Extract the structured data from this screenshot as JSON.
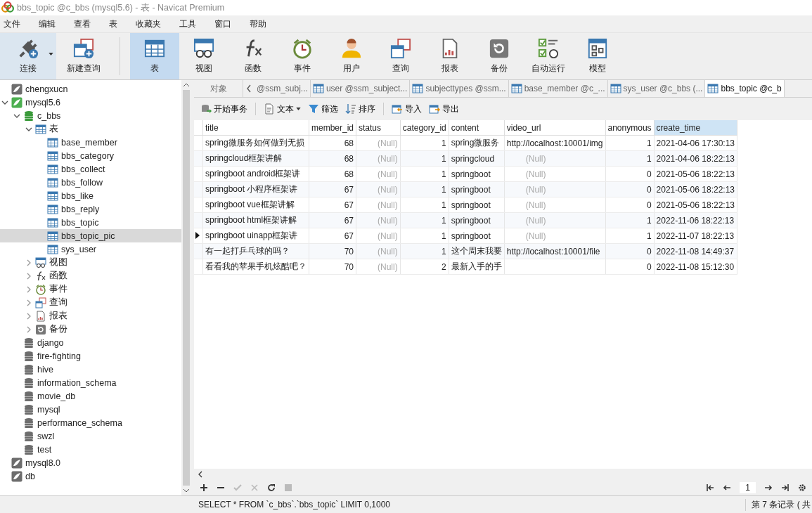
{
  "window": {
    "title": "bbs_topic @c_bbs (mysql5.6) - 表 - Navicat Premium"
  },
  "menu": [
    "文件",
    "编辑",
    "查看",
    "表",
    "收藏夹",
    "工具",
    "窗口",
    "帮助"
  ],
  "toolbar": [
    {
      "kind": "connect",
      "label": "连接",
      "selected": false,
      "dropdown": true
    },
    {
      "kind": "new-query",
      "label": "新建查询",
      "selected": false,
      "dropdown": false
    },
    {
      "kind": "table",
      "label": "表",
      "selected": true,
      "dropdown": false
    },
    {
      "kind": "view",
      "label": "视图",
      "selected": false,
      "dropdown": false
    },
    {
      "kind": "function",
      "label": "函数",
      "selected": false,
      "dropdown": false
    },
    {
      "kind": "event",
      "label": "事件",
      "selected": false,
      "dropdown": false
    },
    {
      "kind": "user",
      "label": "用户",
      "selected": false,
      "dropdown": false
    },
    {
      "kind": "query",
      "label": "查询",
      "selected": false,
      "dropdown": false
    },
    {
      "kind": "report",
      "label": "报表",
      "selected": false,
      "dropdown": false
    },
    {
      "kind": "backup",
      "label": "备份",
      "selected": false,
      "dropdown": false
    },
    {
      "kind": "automation",
      "label": "自动运行",
      "selected": false,
      "dropdown": false
    },
    {
      "kind": "model",
      "label": "模型",
      "selected": false,
      "dropdown": false
    }
  ],
  "tree": [
    {
      "kind": "connection",
      "label": "chengxucn",
      "connected": false,
      "selected": false
    },
    {
      "kind": "connection",
      "label": "mysql5.6",
      "connected": true,
      "expanded": true,
      "selected": false,
      "children": [
        {
          "kind": "database",
          "label": "c_bbs",
          "open": true,
          "expanded": true,
          "selected": false,
          "children": [
            {
              "kind": "table",
              "label": "表",
              "expanded": true,
              "selected": false,
              "children": [
                {
                  "kind": "table",
                  "label": "base_member",
                  "selected": false
                },
                {
                  "kind": "table",
                  "label": "bbs_category",
                  "selected": false
                },
                {
                  "kind": "table",
                  "label": "bbs_collect",
                  "selected": false
                },
                {
                  "kind": "table",
                  "label": "bbs_follow",
                  "selected": false
                },
                {
                  "kind": "table",
                  "label": "bbs_like",
                  "selected": false
                },
                {
                  "kind": "table",
                  "label": "bbs_reply",
                  "selected": false
                },
                {
                  "kind": "table",
                  "label": "bbs_topic",
                  "selected": false
                },
                {
                  "kind": "table",
                  "label": "bbs_topic_pic",
                  "selected": true
                },
                {
                  "kind": "table",
                  "label": "sys_user",
                  "selected": false
                }
              ]
            },
            {
              "kind": "view",
              "label": "视图",
              "expanded": false,
              "selected": false
            },
            {
              "kind": "function",
              "label": "函数",
              "expanded": false,
              "selected": false
            },
            {
              "kind": "event",
              "label": "事件",
              "expanded": false,
              "selected": false
            },
            {
              "kind": "query",
              "label": "查询",
              "expanded": false,
              "selected": false
            },
            {
              "kind": "report",
              "label": "报表",
              "expanded": false,
              "selected": false
            },
            {
              "kind": "backup",
              "label": "备份",
              "expanded": false,
              "selected": false
            }
          ]
        },
        {
          "kind": "database",
          "label": "django",
          "open": false,
          "selected": false
        },
        {
          "kind": "database",
          "label": "fire-fighting",
          "open": false,
          "selected": false
        },
        {
          "kind": "database",
          "label": "hive",
          "open": false,
          "selected": false
        },
        {
          "kind": "database",
          "label": "information_schema",
          "open": false,
          "selected": false
        },
        {
          "kind": "database",
          "label": "movie_db",
          "open": false,
          "selected": false
        },
        {
          "kind": "database",
          "label": "mysql",
          "open": false,
          "selected": false
        },
        {
          "kind": "database",
          "label": "performance_schema",
          "open": false,
          "selected": false
        },
        {
          "kind": "database",
          "label": "swzl",
          "open": false,
          "selected": false
        },
        {
          "kind": "database",
          "label": "test",
          "open": false,
          "selected": false
        }
      ]
    },
    {
      "kind": "connection",
      "label": "mysql8.0",
      "connected": false,
      "selected": false
    },
    {
      "kind": "connection",
      "label": "db",
      "connected": false,
      "selected": false
    }
  ],
  "tabs": [
    {
      "label": "对象",
      "selected": false,
      "icon": false
    },
    {
      "label": "@ssm_subj...",
      "selected": false,
      "icon": false
    },
    {
      "label": "user @ssm_subject...",
      "selected": false,
      "icon": true
    },
    {
      "label": "subjecttypes @ssm...",
      "selected": false,
      "icon": true
    },
    {
      "label": "base_member @c_...",
      "selected": false,
      "icon": true
    },
    {
      "label": "sys_user @c_bbs (...",
      "selected": false,
      "icon": true
    },
    {
      "label": "bbs_topic @c_b",
      "selected": true,
      "icon": true
    }
  ],
  "data_toolbar": [
    {
      "kind": "transaction",
      "label": "开始事务",
      "dropdown": false
    },
    {
      "kind": "text",
      "label": "文本",
      "dropdown": true
    },
    {
      "kind": "filter",
      "label": "筛选",
      "dropdown": false
    },
    {
      "kind": "sort",
      "label": "排序",
      "dropdown": false
    },
    {
      "kind": "import",
      "label": "导入",
      "dropdown": false
    },
    {
      "kind": "export",
      "label": "导出",
      "dropdown": false
    }
  ],
  "table": {
    "columns": [
      {
        "label": "title",
        "kind": "text",
        "selected": false
      },
      {
        "label": "member_id",
        "kind": "number",
        "selected": false
      },
      {
        "label": "status",
        "selected": false
      },
      {
        "label": "category_id",
        "kind": "number",
        "selected": false
      },
      {
        "label": "content",
        "kind": "text",
        "selected": false
      },
      {
        "label": "video_url",
        "kind": "text",
        "selected": false
      },
      {
        "label": "anonymous",
        "kind": "number",
        "selected": false
      },
      {
        "label": "create_time",
        "kind": "text",
        "selected": true
      }
    ],
    "rows": [
      {
        "selected": false,
        "cells": [
          "spring微服务如何做到无损",
          "68",
          {
            "v": "(Null)",
            "null": true
          },
          "1",
          "spring微服务",
          "http://localhost:10001/img",
          "1",
          "2021-04-06 17:30:13"
        ]
      },
      {
        "selected": false,
        "cells": [
          "springcloud框架讲解",
          "68",
          {
            "v": "(Null)",
            "null": true
          },
          "1",
          "springcloud",
          {
            "v": "(Null)",
            "null": true
          },
          "1",
          "2021-04-06 18:22:13"
        ]
      },
      {
        "selected": false,
        "cells": [
          "springboot android框架讲",
          "68",
          {
            "v": "(Null)",
            "null": true
          },
          "1",
          "springboot",
          {
            "v": "(Null)",
            "null": true
          },
          "0",
          "2021-05-06 18:22:13"
        ]
      },
      {
        "selected": false,
        "cells": [
          "springboot 小程序框架讲",
          "67",
          {
            "v": "(Null)",
            "null": true
          },
          "1",
          "springboot",
          {
            "v": "(Null)",
            "null": true
          },
          "0",
          "2021-05-06 18:22:13"
        ]
      },
      {
        "selected": false,
        "cells": [
          "springboot vue框架讲解",
          "67",
          {
            "v": "(Null)",
            "null": true
          },
          "1",
          "springboot",
          {
            "v": "(Null)",
            "null": true
          },
          "0",
          "2021-05-06 18:22:13"
        ]
      },
      {
        "selected": false,
        "cells": [
          "springboot html框架讲解",
          "67",
          {
            "v": "(Null)",
            "null": true
          },
          "1",
          "springboot",
          {
            "v": "(Null)",
            "null": true
          },
          "1",
          "2022-11-06 18:22:13"
        ]
      },
      {
        "selected": true,
        "cells": [
          "springboot uinapp框架讲",
          "67",
          {
            "v": "(Null)",
            "null": true
          },
          "1",
          "springboot",
          {
            "v": "(Null)",
            "null": true
          },
          "1",
          "2022-11-07 18:22:13"
        ]
      },
      {
        "selected": false,
        "cells": [
          "有一起打乒乓球的吗？",
          "70",
          {
            "v": "(Null)",
            "null": true
          },
          "1",
          "这个周末我要",
          "http://localhost:10001/file",
          "0",
          "2022-11-08 14:49:37"
        ]
      },
      {
        "selected": false,
        "cells": [
          "看看我的苹果手机炫酷吧？",
          "70",
          {
            "v": "(Null)",
            "null": true
          },
          "2",
          "最新入手的手",
          null,
          "0",
          "2022-11-08 15:12:30"
        ]
      }
    ]
  },
  "nav": {
    "page": "1"
  },
  "status_bar": {
    "sql": "SELECT * FROM `c_bbs`.`bbs_topic` LIMIT 0,1000",
    "record": "第 7 条记录 ( 共"
  }
}
